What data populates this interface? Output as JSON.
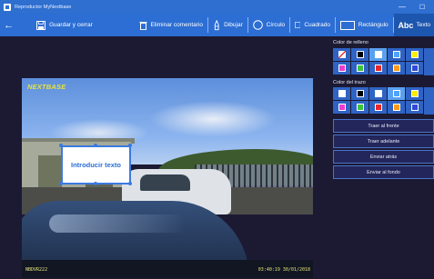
{
  "window": {
    "title": "Reproductor MyNextbase",
    "minimize": "—",
    "maximize": "☐"
  },
  "toolbar": {
    "back": "←",
    "save_label": "Guardar y cerrar",
    "delete_label": "Eliminar comentario",
    "draw_label": "Dibujar",
    "circle_label": "Círculo",
    "square_label": "Cuadrado",
    "rect_label": "Rectángulo",
    "abc_glyph": "Abc",
    "text_label": "Texto"
  },
  "canvas": {
    "logo": "NEXTBASE",
    "stamp_left": "NBDVR222",
    "stamp_right": "03:40:19 30/01/2018",
    "textbox_text": "Introducir texto"
  },
  "panel": {
    "fill_label": "Color de relleno",
    "stroke_label": "Color del trazo",
    "fill_colors": [
      "none",
      "#000000",
      "#ffffff",
      "#4fa3ff",
      "#ffee00",
      "#e83ed0",
      "#3ec23e",
      "#e82828",
      "#ff9a1a",
      "#2f49d8"
    ],
    "stroke_colors": [
      "#ffffff",
      "#000000",
      "#ffffff",
      "#4fa3ff",
      "#ffee00",
      "#e83ed0",
      "#3ec23e",
      "#e82828",
      "#ff9a1a",
      "#2f49d8"
    ],
    "fill_selected_index": 2,
    "stroke_selected_index": 3,
    "actions": [
      "Traer al frente",
      "Traer adelante",
      "Enviar atrás",
      "Enviar al fondo"
    ]
  }
}
